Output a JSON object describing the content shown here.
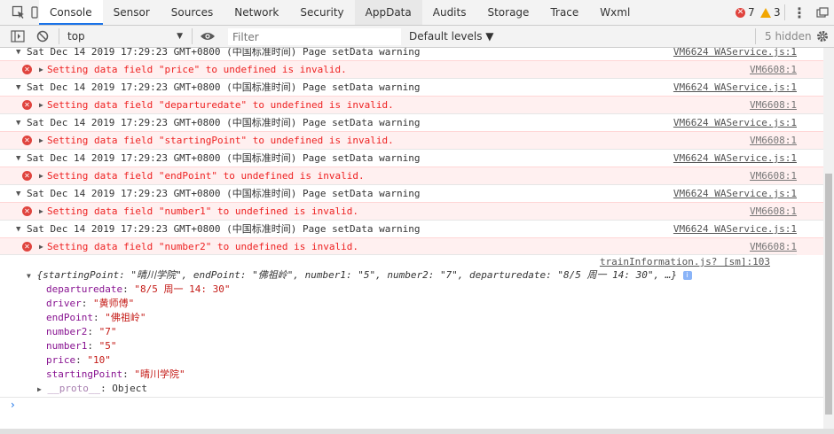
{
  "tabbar": {
    "tabs": [
      "Console",
      "Sensor",
      "Sources",
      "Network",
      "Security",
      "AppData",
      "Audits",
      "Storage",
      "Trace",
      "Wxml"
    ],
    "error_count": "7",
    "warning_count": "3"
  },
  "toolbar": {
    "context": "top",
    "filter_placeholder": "Filter",
    "levels": "Default levels ▼",
    "hidden": "5 hidden"
  },
  "messages": [
    {
      "type": "warn",
      "text": "Sat Dec 14 2019 17:29:23 GMT+0800 (中国标准时间) Page setData warning",
      "src": "VM6624 WAService.js:1"
    },
    {
      "type": "error",
      "text": "Setting data field \"price\" to undefined is invalid.",
      "src": "VM6608:1"
    },
    {
      "type": "warn",
      "text": "Sat Dec 14 2019 17:29:23 GMT+0800 (中国标准时间) Page setData warning",
      "src": "VM6624 WAService.js:1"
    },
    {
      "type": "error",
      "text": "Setting data field \"departuredate\" to undefined is invalid.",
      "src": "VM6608:1"
    },
    {
      "type": "warn",
      "text": "Sat Dec 14 2019 17:29:23 GMT+0800 (中国标准时间) Page setData warning",
      "src": "VM6624 WAService.js:1"
    },
    {
      "type": "error",
      "text": "Setting data field \"startingPoint\" to undefined is invalid.",
      "src": "VM6608:1"
    },
    {
      "type": "warn",
      "text": "Sat Dec 14 2019 17:29:23 GMT+0800 (中国标准时间) Page setData warning",
      "src": "VM6624 WAService.js:1"
    },
    {
      "type": "error",
      "text": "Setting data field \"endPoint\" to undefined is invalid.",
      "src": "VM6608:1"
    },
    {
      "type": "warn",
      "text": "Sat Dec 14 2019 17:29:23 GMT+0800 (中国标准时间) Page setData warning",
      "src": "VM6624 WAService.js:1"
    },
    {
      "type": "error",
      "text": "Setting data field \"number1\" to undefined is invalid.",
      "src": "VM6608:1"
    },
    {
      "type": "warn",
      "text": "Sat Dec 14 2019 17:29:23 GMT+0800 (中国标准时间) Page setData warning",
      "src": "VM6624 WAService.js:1"
    },
    {
      "type": "error",
      "text": "Setting data field \"number2\" to undefined is invalid.",
      "src": "VM6608:1"
    }
  ],
  "log": {
    "src": "trainInformation.js? [sm]:103",
    "summary": "{startingPoint: \"晴川学院\", endPoint: \"佛祖岭\", number1: \"5\", number2: \"7\", departuredate: \"8/5 周一 14: 30\", …}",
    "props": [
      {
        "key": "departuredate",
        "value": "\"8/5 周一 14: 30\""
      },
      {
        "key": "driver",
        "value": "\"黄师傅\""
      },
      {
        "key": "endPoint",
        "value": "\"佛祖岭\""
      },
      {
        "key": "number2",
        "value": "\"7\""
      },
      {
        "key": "number1",
        "value": "\"5\""
      },
      {
        "key": "price",
        "value": "\"10\""
      },
      {
        "key": "startingPoint",
        "value": "\"晴川学院\""
      }
    ],
    "proto_key": "__proto__",
    "proto_value": ": Object"
  },
  "prompt": "›"
}
